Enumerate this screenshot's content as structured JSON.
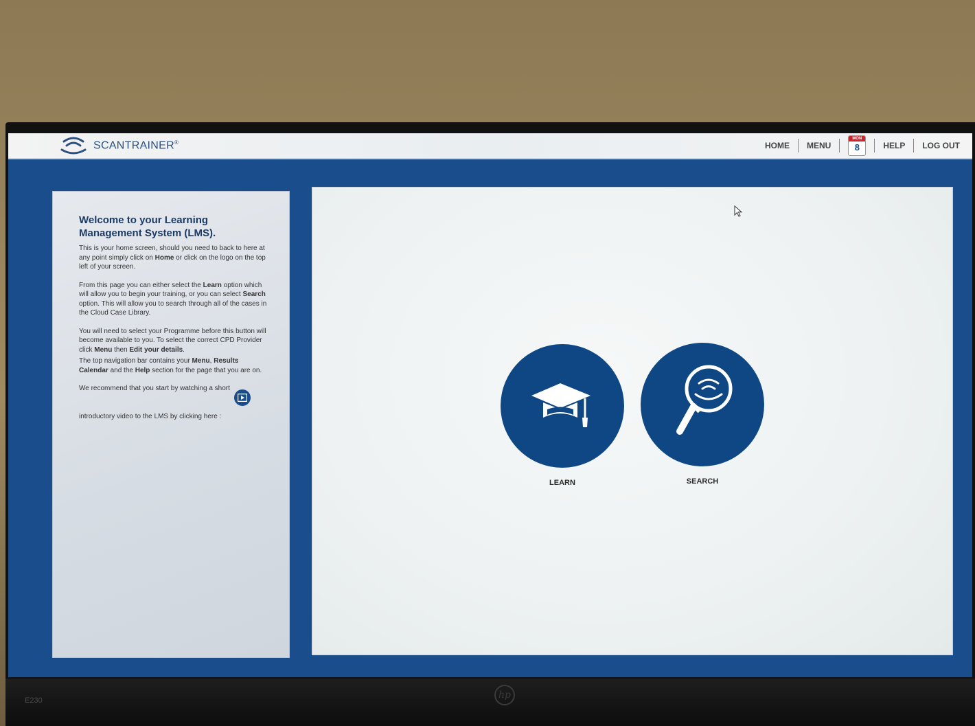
{
  "app": {
    "logo_text": "SCANTRAINER",
    "logo_mark": "®"
  },
  "nav": {
    "home": "HOME",
    "menu": "MENU",
    "calendar": {
      "day_name": "MON",
      "day_number": "8"
    },
    "help": "HELP",
    "logout": "LOG OUT"
  },
  "welcome": {
    "title": "Welcome to your Learning Management System (LMS).",
    "p1_a": "This is your home screen, should you need to back to here at any point simply click on ",
    "p1_b": "Home",
    "p1_c": " or click on the logo on the top left of your screen.",
    "p2_a": "From this page you can either select the ",
    "p2_b": "Learn",
    "p2_c": " option which will allow you to begin your training, or you can select ",
    "p2_d": "Search",
    "p2_e": " option. This will allow you to search through all of the cases in the Cloud Case Library.",
    "p3_a": "You will need to select your Programme before this button will become available to you. To select the correct CPD Provider click ",
    "p3_b": "Menu",
    "p3_c": " then ",
    "p3_d": "Edit your details",
    "p3_e": ".",
    "p4_a": "The top navigation bar contains your ",
    "p4_b": "Menu",
    "p4_c": ", ",
    "p4_d": "Results Calendar",
    "p4_e": " and the ",
    "p4_f": "Help",
    "p4_g": " section for the page that you are on.",
    "p5_a": "We recommend that you start by watching a short",
    "p5_b": "introductory video to the LMS by clicking here :"
  },
  "tiles": {
    "learn": "LEARN",
    "search": "SEARCH"
  },
  "monitor": {
    "model": "E230",
    "brand": "hp"
  },
  "colors": {
    "brand_blue": "#0e4784",
    "background_blue": "#1a4d8c",
    "calendar_red": "#c8262c"
  },
  "icons": {
    "logo": "wave-signal-icon",
    "calendar": "calendar-icon",
    "video": "play-video-icon",
    "learn": "graduation-cap-icon",
    "search": "magnifier-signal-icon",
    "cursor": "mouse-pointer-icon"
  }
}
